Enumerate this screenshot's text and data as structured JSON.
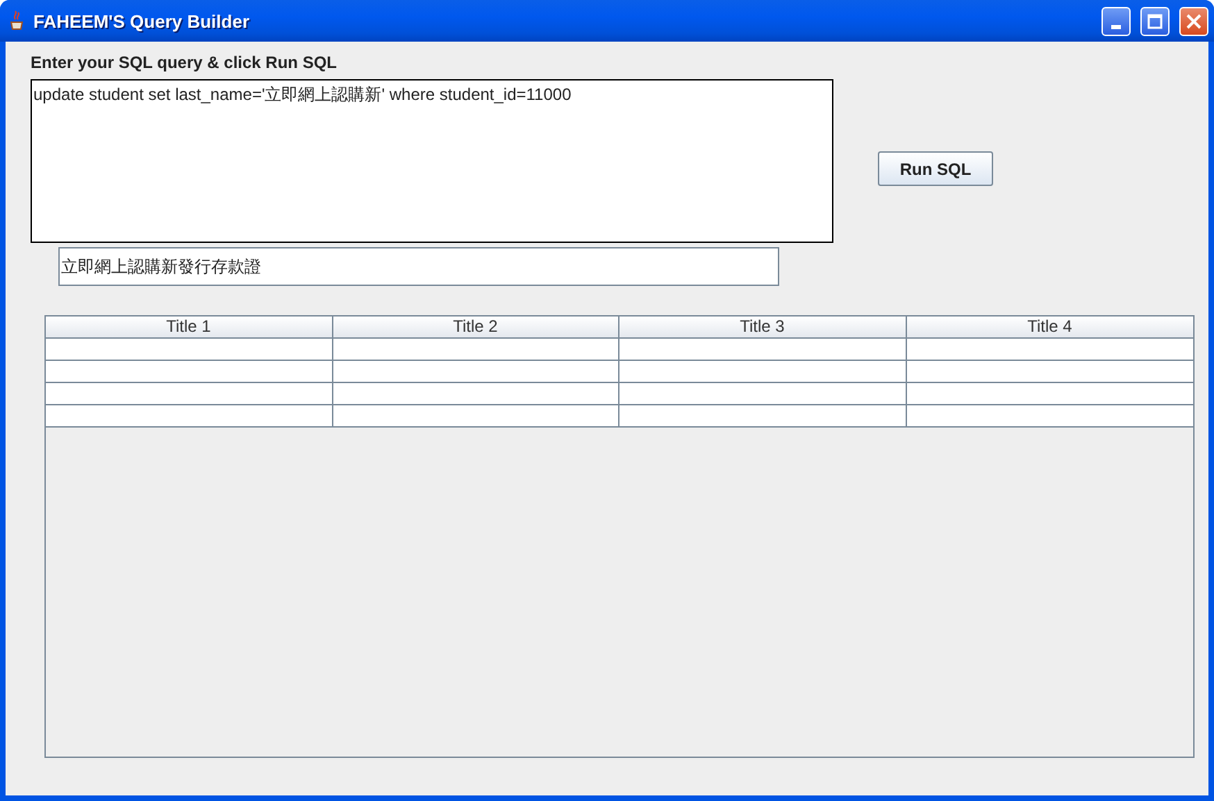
{
  "window": {
    "title": "FAHEEM'S Query Builder"
  },
  "prompt": "Enter your SQL query & click Run SQL",
  "query": "update student set last_name='立即網上認購新' where student_id=11000",
  "result_field": "立即網上認購新發行存款證",
  "run_button": "Run SQL",
  "table": {
    "columns": [
      "Title 1",
      "Title 2",
      "Title 3",
      "Title 4"
    ]
  }
}
